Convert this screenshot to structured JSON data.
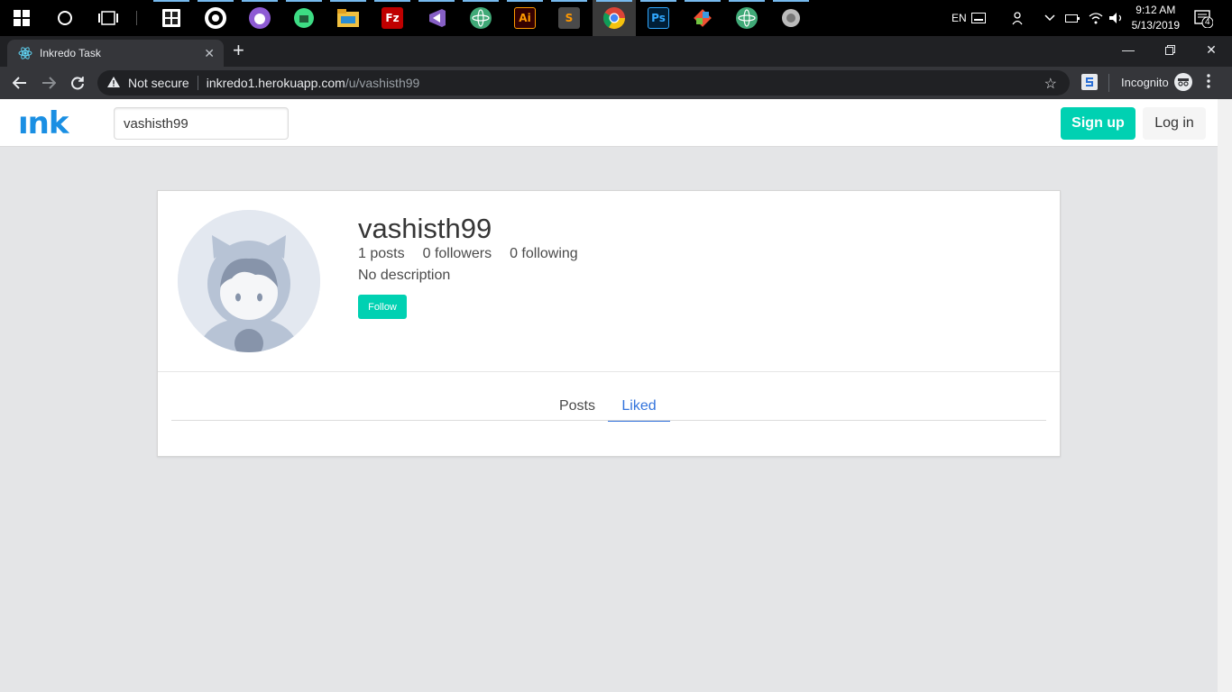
{
  "taskbar": {
    "apps": [
      {
        "name": "store",
        "label": ""
      },
      {
        "name": "obs",
        "label": ""
      },
      {
        "name": "github-desktop",
        "label": ""
      },
      {
        "name": "android-studio",
        "label": ""
      },
      {
        "name": "file-explorer",
        "label": ""
      },
      {
        "name": "filezilla",
        "label": "Fz"
      },
      {
        "name": "visual-studio",
        "label": ""
      },
      {
        "name": "atom",
        "label": ""
      },
      {
        "name": "illustrator",
        "label": "Ai"
      },
      {
        "name": "sublime-text",
        "label": "S"
      },
      {
        "name": "chrome",
        "label": ""
      },
      {
        "name": "photoshop",
        "label": "Ps"
      },
      {
        "name": "git",
        "label": ""
      },
      {
        "name": "atom-2",
        "label": ""
      },
      {
        "name": "app-gray",
        "label": ""
      }
    ],
    "language": "EN",
    "time": "9:12 AM",
    "date": "5/13/2019",
    "notifications": "4"
  },
  "browser": {
    "tab_title": "Inkredo Task",
    "security_label": "Not secure",
    "url_host": "inkredo1.herokuapp.com",
    "url_path": "/u/vashisth99",
    "incognito_label": "Incognito"
  },
  "site": {
    "logo": "ınk",
    "search_value": "vashisth99",
    "signup_label": "Sign up",
    "login_label": "Log in"
  },
  "profile": {
    "username": "vashisth99",
    "posts": "1 posts",
    "followers": "0 followers",
    "following": "0 following",
    "description": "No description",
    "follow_label": "Follow",
    "tabs": [
      {
        "label": "Posts",
        "active": false
      },
      {
        "label": "Liked",
        "active": true
      }
    ]
  },
  "colors": {
    "brand": "#1a8fe3",
    "primary": "#00d1b2",
    "link": "#3273dc"
  }
}
